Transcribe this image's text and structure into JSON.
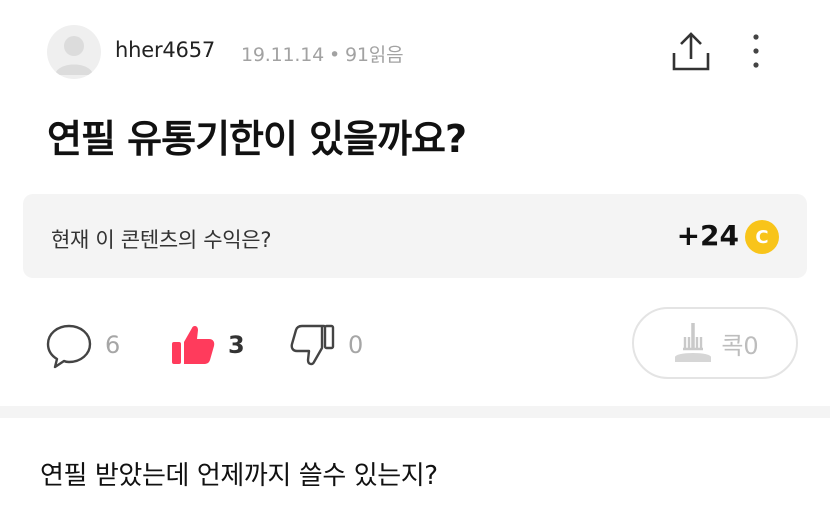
{
  "post": {
    "author": "hher4657",
    "date": "19.11.14",
    "views": "91읽음",
    "title": "연필 유통기한이 있을까요?",
    "body": "연필 받았는데 언제까지 쓸수 있는지?"
  },
  "revenue": {
    "label": "현재 이 콘텐츠의 수익은?",
    "amount": "+24",
    "coin_symbol": "C",
    "coin_color": "#f8c41a"
  },
  "actions": {
    "comments": "6",
    "likes": "3",
    "dislikes": "0",
    "kok_label": "콕0",
    "like_color": "#ff3b5c"
  },
  "icons": {
    "share": "share-icon",
    "more": "more-vertical-icon",
    "comment": "comment-bubble-icon",
    "like": "thumbs-up-icon",
    "dislike": "thumbs-down-icon",
    "kok": "fork-plate-icon"
  }
}
